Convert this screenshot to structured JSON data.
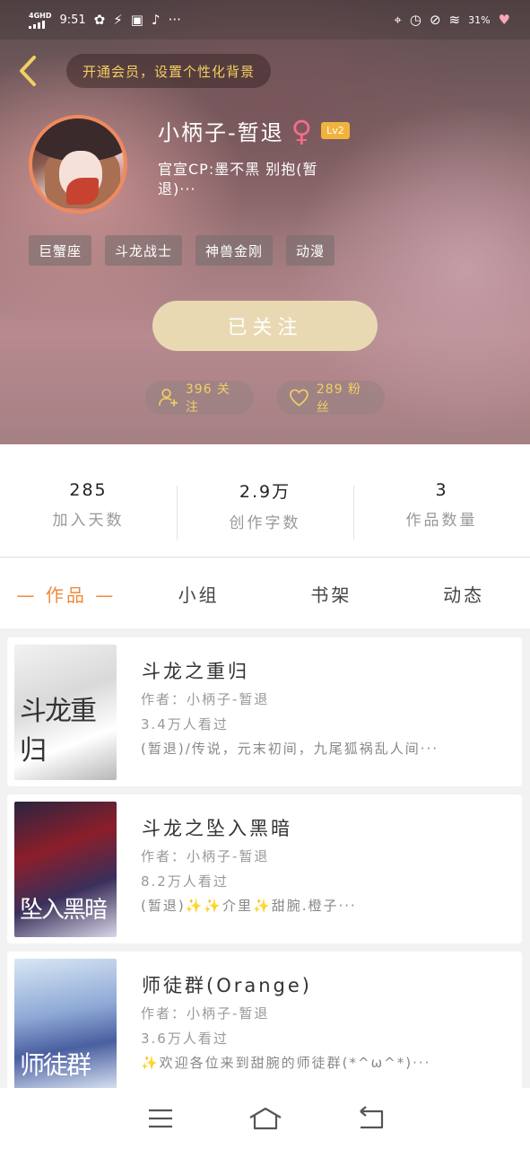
{
  "status_bar": {
    "network": "4GHD",
    "time": "9:51",
    "battery": "31%",
    "icons": [
      "signal-icon",
      "pinwheel-icon",
      "sports-icon",
      "hd-icon",
      "bell-icon",
      "more-icon",
      "location-icon",
      "alarm-icon",
      "mute-icon",
      "wifi-icon",
      "heart-icon"
    ]
  },
  "header": {
    "vip_prompt": "开通会员，设置个性化背景",
    "name": "小柄子-暂退",
    "level": "Lv2",
    "bio": "官宣CP:墨不黑 别抱(暂退)···",
    "tags": [
      "巨蟹座",
      "斗龙战士",
      "神兽金刚",
      "动漫"
    ],
    "follow_button": "已关注",
    "following_label": "396 关注",
    "fans_label": "289 粉丝"
  },
  "stats": [
    {
      "value": "285",
      "label": "加入天数"
    },
    {
      "value": "2.9万",
      "label": "创作字数"
    },
    {
      "value": "3",
      "label": "作品数量"
    }
  ],
  "tabs": {
    "works": "— 作品 —",
    "groups": "小组",
    "bookshelf": "书架",
    "feed": "动态"
  },
  "works": [
    {
      "title": "斗龙之重归",
      "author": "作者：小柄子-暂退",
      "reads": "3.4万人看过",
      "desc": "(暂退)/传说，元末初间，九尾狐祸乱人间···",
      "cover_text": "斗龙重归"
    },
    {
      "title": "斗龙之坠入黑暗",
      "author": "作者：小柄子-暂退",
      "reads": "8.2万人看过",
      "desc": "(暂退)✨✨介里✨甜腕.橙子···",
      "cover_text": "坠入黑暗"
    },
    {
      "title": "师徒群(Orange)",
      "author": "作者：小柄子-暂退",
      "reads": "3.6万人看过",
      "desc": "✨欢迎各位来到甜腕的师徒群(*^ω^*)···",
      "cover_text": "师徒群"
    }
  ],
  "colors": {
    "accent": "#f08a3c",
    "gold": "#f1cf63",
    "follow_btn": "#e8d9b3",
    "female": "#f56c8b",
    "level_badge": "#f2b33d"
  }
}
